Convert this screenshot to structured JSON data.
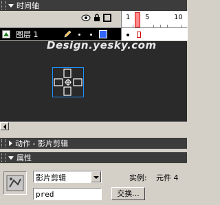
{
  "timeline": {
    "title": "时间轴",
    "ruler_labels": [
      "1",
      "5",
      "10"
    ],
    "layer": {
      "name": "图层 1"
    },
    "icons": [
      "eye-icon",
      "lock-icon",
      "outline-icon"
    ]
  },
  "stage": {
    "watermark": "Design.yesky.com"
  },
  "actions_panel": {
    "title": "动作 - 影片剪辑"
  },
  "properties_panel": {
    "title": "属性",
    "symbol_type": "影片剪辑",
    "instance_name": "pred",
    "instance_label": "实例:",
    "instance_value": "元件 4",
    "swap_button": "交换..."
  },
  "colors": {
    "panel_header": "#3c3c3c",
    "stage_bg": "#2a2a2a",
    "selection": "#1e90ff",
    "playhead": "#ff8c8c",
    "layer_swatch": "#3366ff"
  }
}
